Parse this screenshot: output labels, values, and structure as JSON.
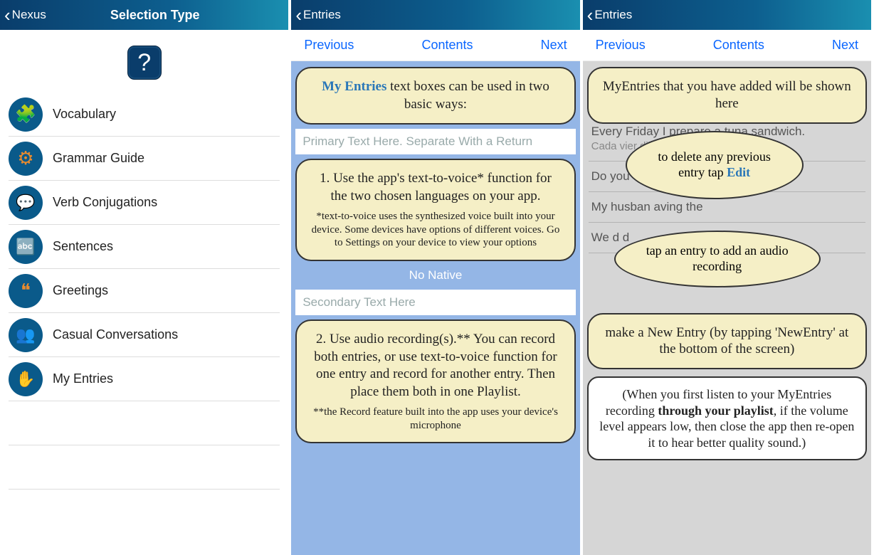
{
  "panel1": {
    "back_label": "Nexus",
    "title": "Selection Type",
    "help_symbol": "?",
    "items": [
      {
        "label": "Vocabulary",
        "icon": "puzzle-icon"
      },
      {
        "label": "Grammar Guide",
        "icon": "gears-icon"
      },
      {
        "label": "Verb Conjugations",
        "icon": "chat-icon"
      },
      {
        "label": "Sentences",
        "icon": "abc-icon"
      },
      {
        "label": "Greetings",
        "icon": "quotes-icon"
      },
      {
        "label": "Casual Conversations",
        "icon": "people-icon"
      },
      {
        "label": "My Entries",
        "icon": "hand-icon"
      }
    ]
  },
  "panel2": {
    "back_label": "Entries",
    "nav": {
      "prev": "Previous",
      "contents": "Contents",
      "next": "Next"
    },
    "top_callout_emph": "My Entries",
    "top_callout_rest": " text boxes can be used in two basic ways:",
    "placeholder1": "Primary Text Here. Separate With a Return",
    "callout1_main": "1. Use the app's text-to-voice* function for the two chosen languages on your app.",
    "callout1_small": "*text-to-voice uses the synthesized voice built into your device. Some devices have options of different voices. Go to Settings on your device to view your options",
    "no_native": "No Native",
    "placeholder2": "Secondary Text Here",
    "callout2_main": "2. Use audio recording(s).** You can record both entries, or use text-to-voice function for one entry and record for another entry. Then place them both in one Playlist.",
    "callout2_small": "**the Record feature built into the app uses your device's microphone"
  },
  "panel3": {
    "back_label": "Entries",
    "nav": {
      "prev": "Previous",
      "contents": "Contents",
      "next": "Next"
    },
    "top_callout": "MyEntries that you have added will be shown here",
    "bg_entries": [
      {
        "primary": "Every Friday I prepare a tuna sandwich.",
        "secondary": "Cada vier                                  dillo de a..."
      },
      {
        "primary": "Do you",
        "secondary": ""
      },
      {
        "primary": "My husban                                    aving the",
        "secondary": ""
      },
      {
        "primary": "We d                                                           d",
        "secondary": ""
      }
    ],
    "ellipse1_pre": "to delete any previous entry tap ",
    "ellipse1_link": "Edit",
    "ellipse2": "tap an entry to add an audio recording",
    "callout_mid": "make a New Entry (by tapping 'NewEntry' at the bottom of the screen)",
    "white_callout_pre": "(When you first listen to your MyEntries recording ",
    "white_callout_bold": "through your playlist",
    "white_callout_post": ", if the volume level appears low, then close the app then re-open it to hear better quality sound.)"
  }
}
